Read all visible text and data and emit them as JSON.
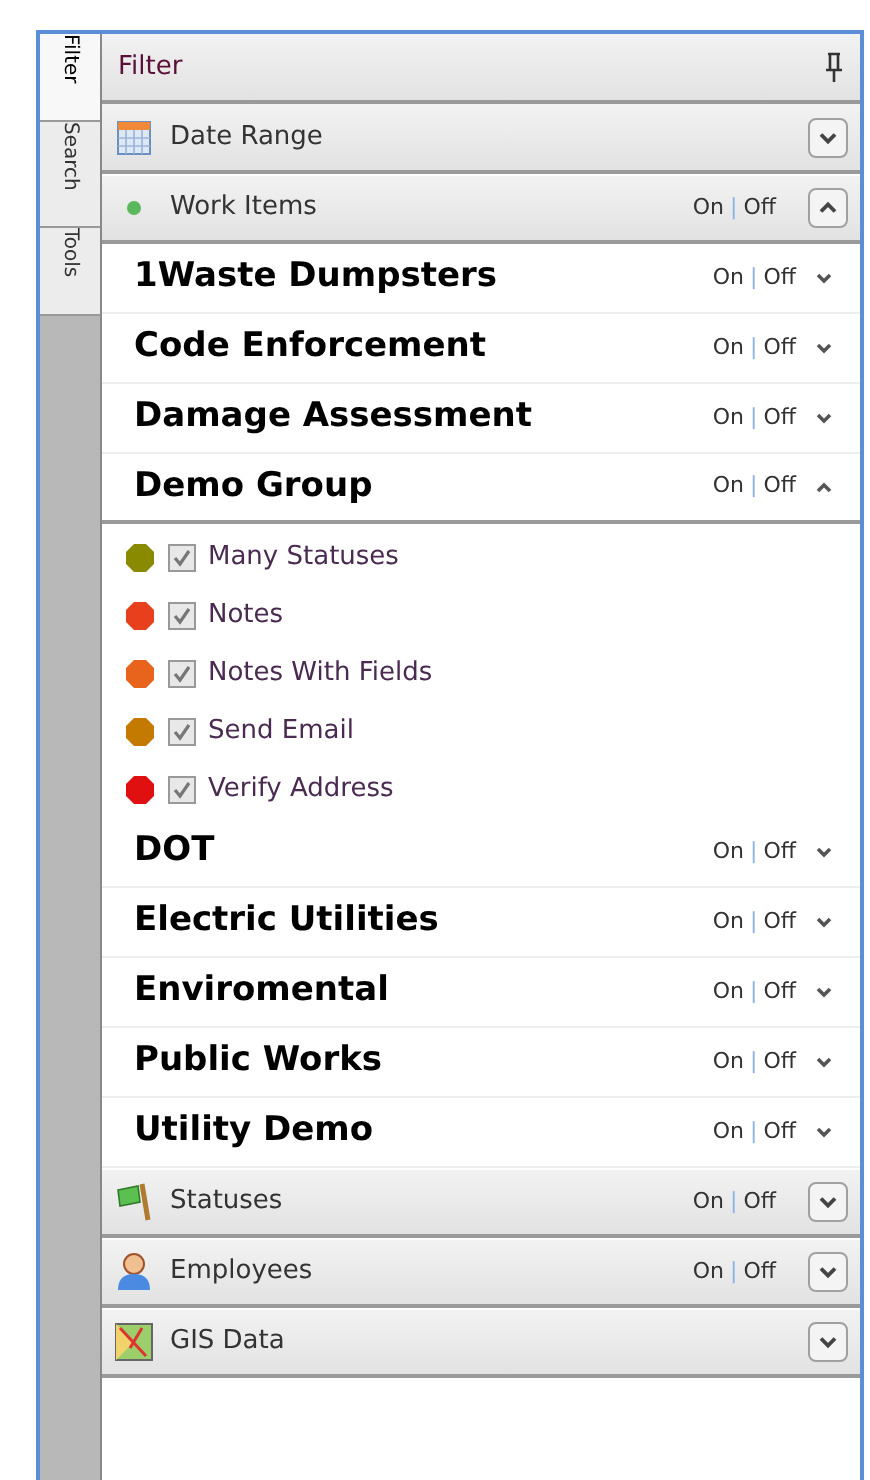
{
  "side_tabs": [
    {
      "label": "Filter",
      "selected": true
    },
    {
      "label": "Search",
      "selected": false
    },
    {
      "label": "Tools",
      "selected": false
    }
  ],
  "panel": {
    "title": "Filter"
  },
  "sections": [
    {
      "title": "Date Range",
      "expanded": false
    },
    {
      "title": "Work Items",
      "expanded": true,
      "toggle": {
        "on": "On",
        "separator": "|",
        "off": "Off"
      },
      "groups": [
        {
          "name": "1Waste Dumpsters",
          "expanded": false,
          "toggle": {
            "on": "On",
            "separator": "|",
            "off": "Off"
          }
        },
        {
          "name": "Code Enforcement",
          "expanded": false,
          "toggle": {
            "on": "On",
            "separator": "|",
            "off": "Off"
          }
        },
        {
          "name": "Damage Assessment",
          "expanded": false,
          "toggle": {
            "on": "On",
            "separator": "|",
            "off": "Off"
          }
        },
        {
          "name": "Demo Group",
          "expanded": true,
          "toggle": {
            "on": "On",
            "separator": "|",
            "off": "Off"
          },
          "items": [
            {
              "label": "Many Statuses",
              "checked": true,
              "color": "#8a8a00"
            },
            {
              "label": "Notes",
              "checked": true,
              "color": "#e8401c"
            },
            {
              "label": "Notes With Fields",
              "checked": true,
              "color": "#e8641c"
            },
            {
              "label": "Send Email",
              "checked": true,
              "color": "#c47a00"
            },
            {
              "label": "Verify Address",
              "checked": true,
              "color": "#e01010"
            }
          ]
        },
        {
          "name": "DOT",
          "expanded": false,
          "toggle": {
            "on": "On",
            "separator": "|",
            "off": "Off"
          }
        },
        {
          "name": "Electric Utilities",
          "expanded": false,
          "toggle": {
            "on": "On",
            "separator": "|",
            "off": "Off"
          }
        },
        {
          "name": "Enviromental",
          "expanded": false,
          "toggle": {
            "on": "On",
            "separator": "|",
            "off": "Off"
          }
        },
        {
          "name": "Public Works",
          "expanded": false,
          "toggle": {
            "on": "On",
            "separator": "|",
            "off": "Off"
          }
        },
        {
          "name": "Utility Demo",
          "expanded": false,
          "toggle": {
            "on": "On",
            "separator": "|",
            "off": "Off"
          }
        }
      ]
    },
    {
      "title": "Statuses",
      "expanded": false,
      "toggle": {
        "on": "On",
        "separator": "|",
        "off": "Off"
      }
    },
    {
      "title": "Employees",
      "expanded": false,
      "toggle": {
        "on": "On",
        "separator": "|",
        "off": "Off"
      }
    },
    {
      "title": "GIS Data",
      "expanded": false
    }
  ]
}
